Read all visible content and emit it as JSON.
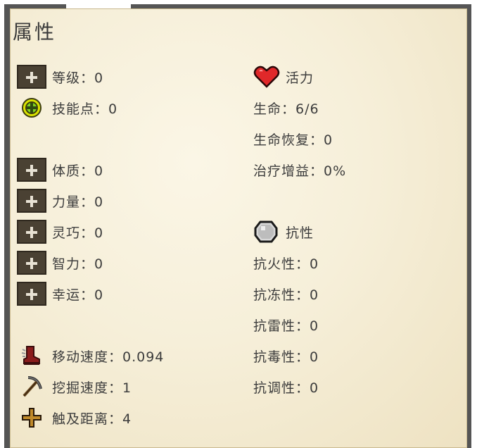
{
  "title": "属性",
  "left": {
    "level": "等级：0",
    "skill_points": "技能点：0",
    "constitution": "体质：0",
    "strength": "力量：0",
    "dexterity": "灵巧：0",
    "intelligence": "智力：0",
    "luck": "幸运：0",
    "move_speed": "移动速度：0.094",
    "dig_speed": "挖掘速度：1",
    "reach": "触及距离：4"
  },
  "right": {
    "vitality_header": "活力",
    "life": "生命：6/6",
    "life_regen": "生命恢复：0",
    "heal_bonus": "治疗增益：0%",
    "resist_header": "抗性",
    "fire": "抗火性：0",
    "frost": "抗冻性：0",
    "thunder": "抗雷性：0",
    "poison": "抗毒性：0",
    "tune": "抗调性：0"
  },
  "colors": {
    "panel_border": "#555555",
    "parchment": "#f6efd9",
    "button": "#4a4133",
    "heart": "#e0282a"
  },
  "icons": {
    "add": "plus-icon",
    "skill": "skill-point-icon",
    "vitality": "heart-icon",
    "resist": "shield-icon",
    "move": "boot-icon",
    "dig": "pickaxe-icon",
    "reach": "cross-icon"
  }
}
